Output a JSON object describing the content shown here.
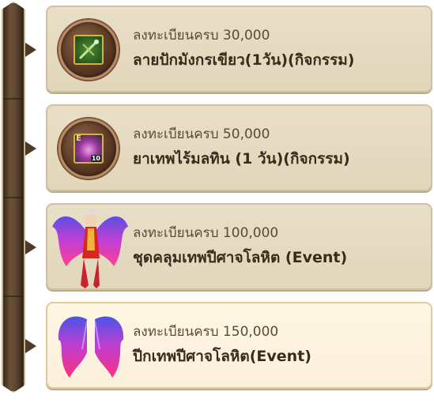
{
  "rewards": [
    {
      "requirement": "ลงทะเบียนครบ 30,000",
      "item": "ลายปักมังกรเขียว(1วัน)(กิจกรรม)",
      "icon": "jade-dragon-embroidery-icon"
    },
    {
      "requirement": "ลงทะเบียนครบ 50,000",
      "item": "ยาเทพไร้มลทิน (1 วัน)(กิจกรรม)",
      "icon": "potion-icon",
      "icon_tag": "E",
      "icon_count": "10"
    },
    {
      "requirement": "ลงทะเบียนครบ 100,000",
      "item": "ชุดคลุมเทพปีศาจโลหิต  (Event)",
      "icon": "winged-costume-icon"
    },
    {
      "requirement": "ลงทะเบียนครบ 150,000",
      "item": "ปีกเทพปีศาจโลหิต(Event)",
      "icon": "crimson-wings-icon"
    }
  ],
  "colors": {
    "card": "#e6dbc1",
    "card_highlight": "#fcf2de",
    "rail": "#5b4430",
    "text": "#3b2a1b"
  }
}
